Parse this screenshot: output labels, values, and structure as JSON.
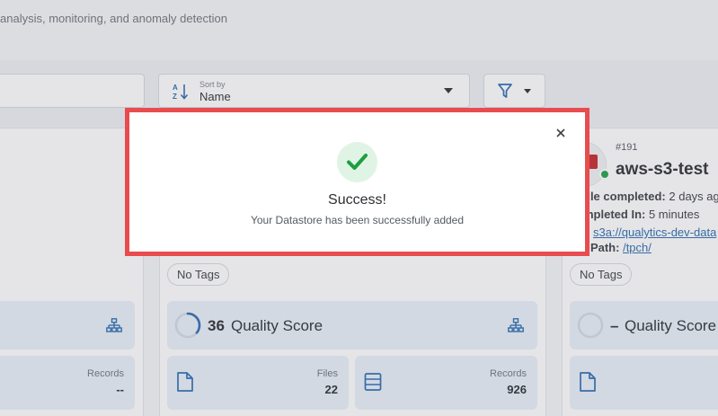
{
  "header": {
    "subtitle": "analysis, monitoring, and anomaly detection"
  },
  "toolbar": {
    "sort_caption": "Sort by",
    "sort_value": "Name"
  },
  "cards": {
    "left": {
      "records_label": "Records",
      "records_value": "--"
    },
    "middle": {
      "tag": "No Tags",
      "quality_score_value": "36",
      "quality_score_label": "Quality Score",
      "quality_score_fraction": 0.36,
      "files_label": "Files",
      "files_value": "22",
      "records_label": "Records",
      "records_value": "926"
    },
    "right": {
      "id": "#191",
      "name": "aws-s3-test",
      "profile_label": "file completed:",
      "profile_value": "2 days ag",
      "completed_in_label": "mpleted In:",
      "completed_in_value": "5 minutes",
      "uri_value": "s3a://qualytics-dev-data",
      "root_path_label": "t Path:",
      "root_path_value": "/tpch/",
      "tag": "No Tags",
      "quality_score_value": "–",
      "quality_score_label": "Quality Score"
    }
  },
  "modal": {
    "title": "Success!",
    "message": "Your Datastore has been successfully added",
    "icon": "checkmark-icon",
    "close_icon": "close-icon"
  },
  "colors": {
    "modal_border": "#e84c4f",
    "success_green": "#1e9e3e",
    "accent_blue": "#2b6cb0",
    "status_green": "#1ea34a"
  }
}
